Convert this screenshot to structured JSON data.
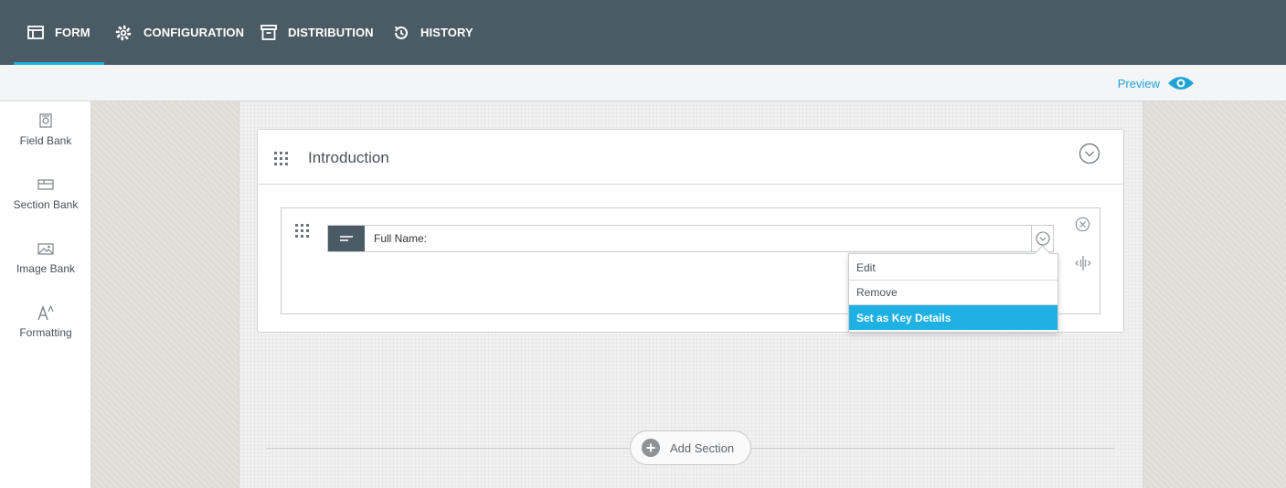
{
  "nav": {
    "tabs": [
      {
        "label": "FORM",
        "icon": "table-icon",
        "active": true
      },
      {
        "label": "CONFIGURATION",
        "icon": "gear-icon"
      },
      {
        "label": "DISTRIBUTION",
        "icon": "archive-box-icon"
      },
      {
        "label": "HISTORY",
        "icon": "history-clock-icon"
      }
    ]
  },
  "toolbar": {
    "preview_label": "Preview"
  },
  "sidebar": {
    "items": [
      {
        "label": "Field Bank",
        "icon": "field-bank-icon"
      },
      {
        "label": "Section Bank",
        "icon": "section-bank-icon"
      },
      {
        "label": "Image Bank",
        "icon": "image-icon"
      },
      {
        "label": "Formatting",
        "icon": "text-format-icon"
      }
    ]
  },
  "section": {
    "title": "Introduction",
    "field": {
      "label": "Full Name:",
      "type_icon": "text-field-icon"
    }
  },
  "field_menu": {
    "items": [
      "Edit",
      "Remove",
      "Set as Key Details"
    ],
    "highlighted": "Set as Key Details"
  },
  "add_section_label": "Add Section",
  "colors": {
    "nav_bg": "#4b5b65",
    "accent": "#1fb1e4",
    "canvas_bg": "#f1f1f1"
  }
}
